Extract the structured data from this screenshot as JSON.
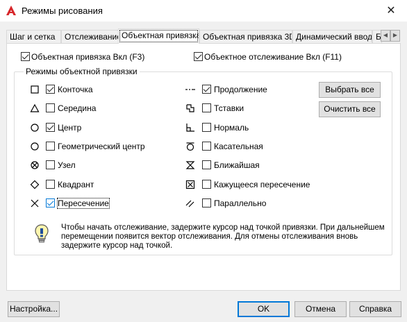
{
  "window": {
    "title": "Режимы рисования",
    "close_symbol": "✕",
    "app_icon": "autocad-logo-icon"
  },
  "tabs": [
    {
      "label": "Шаг и сетка"
    },
    {
      "label": "Отслеживание"
    },
    {
      "label": "Объектная привязка",
      "active": true
    },
    {
      "label": "Объектная привязка 3D"
    },
    {
      "label": "Динамический ввод"
    },
    {
      "label": "Б"
    }
  ],
  "tab_scroll": {
    "left": "◀",
    "right": "▶"
  },
  "toggles": {
    "osnap_on": {
      "label": "Объектная привязка Вкл (F3)",
      "checked": true
    },
    "otrack_on": {
      "label": "Объектное отслеживание Вкл (F11)",
      "checked": true
    }
  },
  "group": {
    "title": "Режимы объектной привязки"
  },
  "modes_left": [
    {
      "label": "Конточка",
      "checked": true,
      "icon": "endpoint-square-icon"
    },
    {
      "label": "Середина",
      "checked": false,
      "icon": "midpoint-triangle-icon"
    },
    {
      "label": "Центр",
      "checked": true,
      "icon": "center-circle-icon"
    },
    {
      "label": "Геометрический центр",
      "checked": false,
      "icon": "geometric-center-icon"
    },
    {
      "label": "Узел",
      "checked": false,
      "icon": "node-icon"
    },
    {
      "label": "Квадрант",
      "checked": false,
      "icon": "quadrant-diamond-icon"
    },
    {
      "label": "Пересечение",
      "checked": true,
      "icon": "intersection-x-icon"
    }
  ],
  "modes_right": [
    {
      "label": "Продолжение",
      "checked": true,
      "icon": "extension-icon"
    },
    {
      "label": "Тставки",
      "checked": false,
      "icon": "insertion-icon"
    },
    {
      "label": "Нормаль",
      "checked": false,
      "icon": "perpendicular-icon"
    },
    {
      "label": "Касательная",
      "checked": false,
      "icon": "tangent-icon"
    },
    {
      "label": "Ближайшая",
      "checked": false,
      "icon": "nearest-hourglass-icon"
    },
    {
      "label": "Кажущееся пересечение",
      "checked": false,
      "icon": "apparent-intersection-icon"
    },
    {
      "label": "Параллельно",
      "checked": false,
      "icon": "parallel-icon"
    }
  ],
  "side_buttons": {
    "select_all": "Выбрать все",
    "clear_all": "Очистить все"
  },
  "info": {
    "icon": "lightbulb-icon",
    "text": "Чтобы начать отслеживание, задержите курсор над точкой привязки. При дальнейшем перемещении появится вектор отслеживания. Для отмены отслеживания вновь задержите курсор над точкой."
  },
  "footer": {
    "options": "Настройка...",
    "ok": "OK",
    "cancel": "Отмена",
    "help": "Справка"
  }
}
